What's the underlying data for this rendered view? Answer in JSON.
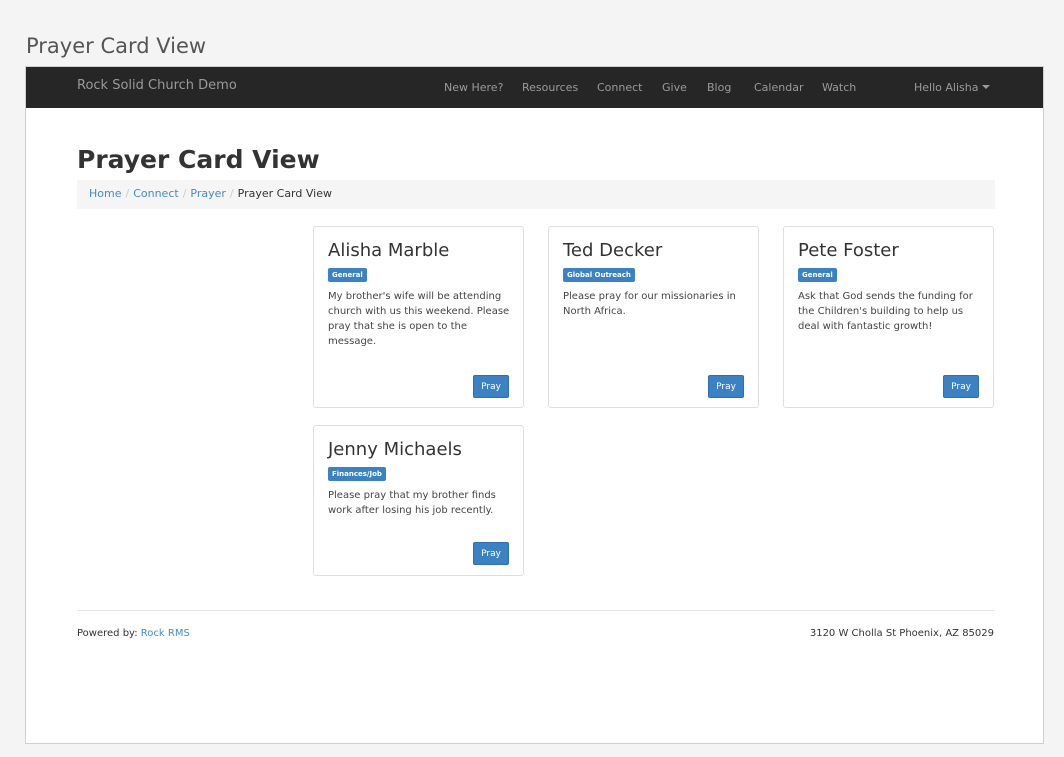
{
  "page": {
    "outer_title": "Prayer Card View"
  },
  "navbar": {
    "brand": "Rock Solid Church Demo",
    "links": [
      "New Here?",
      "Resources",
      "Connect",
      "Give",
      "Blog",
      "Calendar",
      "Watch"
    ],
    "user_menu": "Hello Alisha"
  },
  "main": {
    "title": "Prayer Card View",
    "breadcrumb": {
      "home": "Home",
      "connect": "Connect",
      "prayer": "Prayer",
      "current": "Prayer Card View",
      "separator": "/"
    }
  },
  "cards": [
    {
      "name": "Alisha Marble",
      "category": "General",
      "text": "My brother's wife will be attending church with us this weekend. Please pray that she is open to the message.",
      "button": "Pray"
    },
    {
      "name": "Ted Decker",
      "category": "Global Outreach",
      "text": "Please pray for our missionaries in North Africa.",
      "button": "Pray"
    },
    {
      "name": "Pete Foster",
      "category": "General",
      "text": "Ask that God sends the funding for the Children's building to help us deal with fantastic growth!",
      "button": "Pray"
    },
    {
      "name": "Jenny Michaels",
      "category": "Finances/Job",
      "text": "Please pray that my brother finds work after losing his job recently.",
      "button": "Pray"
    }
  ],
  "footer": {
    "powered_label": "Powered by:",
    "powered_link": "Rock RMS",
    "address": "3120 W Cholla St Phoenix, AZ 85029"
  },
  "colors": {
    "navbar_bg": "#262626",
    "accent": "#3b82c4",
    "link": "#428bca"
  }
}
